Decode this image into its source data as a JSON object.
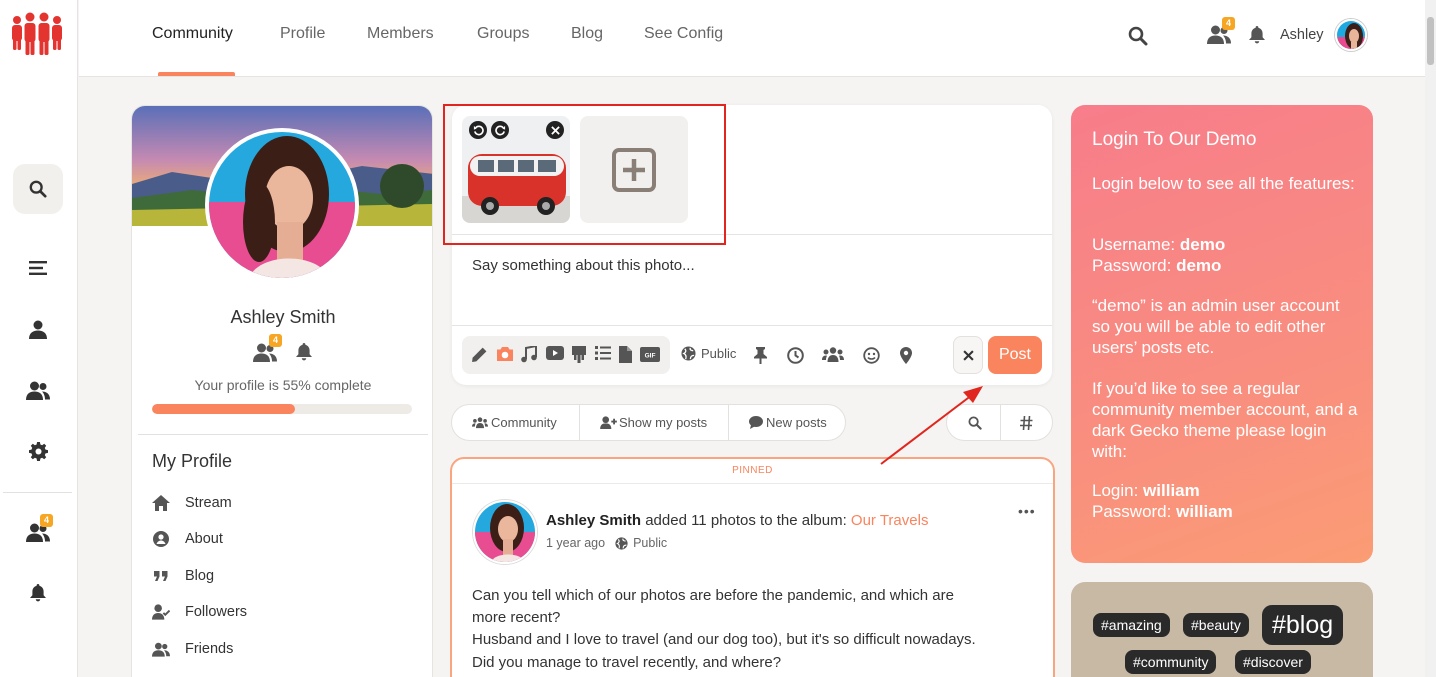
{
  "nav": {
    "items": [
      "Community",
      "Profile",
      "Members",
      "Groups",
      "Blog",
      "See Config"
    ],
    "active": "Community",
    "user_name": "Ashley",
    "friends_badge": "4"
  },
  "rail": {
    "friends_badge": "4"
  },
  "profile": {
    "name": "Ashley Smith",
    "friends_badge": "4",
    "completion_text": "Your profile is 55% complete",
    "completion_percent": 55,
    "menu_title": "My Profile",
    "menu": [
      "Stream",
      "About",
      "Blog",
      "Followers",
      "Friends"
    ]
  },
  "composer": {
    "text": "Say something about this photo...",
    "privacy": "Public",
    "post_label": "Post"
  },
  "filters": {
    "items": [
      "Community",
      "Show my posts",
      "New posts"
    ]
  },
  "post": {
    "pinned_label": "PINNED",
    "author": "Ashley Smith",
    "action": " added 11 photos to the album: ",
    "album": "Our Travels",
    "time": "1 year ago",
    "privacy": "Public",
    "lines": [
      "Can you tell which of our photos are before the pandemic, and which are",
      "more recent?",
      "Husband and I love to travel (and our dog too), but it's so difficult nowadays.",
      "Did you manage to travel recently, and where?"
    ]
  },
  "login_card": {
    "title": "Login To Our Demo",
    "intro": "Login below to see all the features:",
    "username_label": "Username: ",
    "username": "demo",
    "password_label": "Password: ",
    "password": "demo",
    "admin_note": "“demo” is an admin user account so you will be able to edit other users’ posts etc.",
    "member_note": "If you’d like to see a regular community member account, and a dark Gecko theme please login with:",
    "login_label": "Login: ",
    "login": "william",
    "password2_label": "Password: ",
    "password2": "william"
  },
  "tags": [
    "#amazing",
    "#beauty",
    "#blog",
    "#community",
    "#discover"
  ],
  "colors": {
    "accent": "#f9845e",
    "badge": "#f6a623",
    "highlight_box": "#e0261e",
    "login_card": "#f98e7f",
    "tags_card": "#c8b9a5"
  }
}
